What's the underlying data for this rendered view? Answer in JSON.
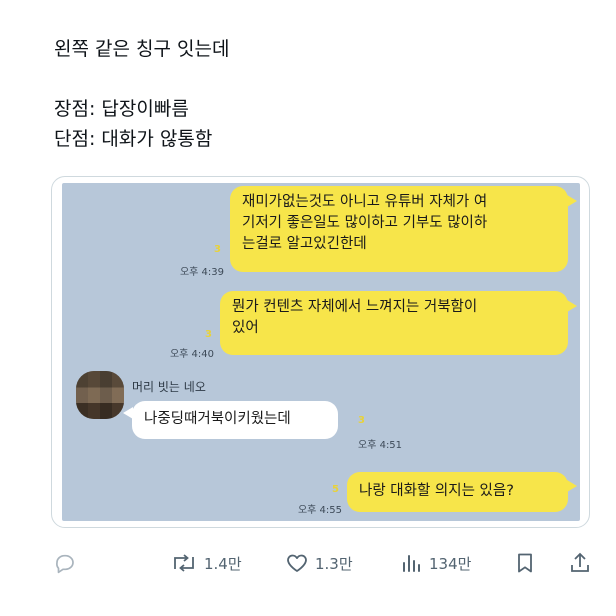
{
  "post": {
    "lines": [
      "왼쪽 같은 칭구 잇는데",
      "",
      "장점: 답장이빠름",
      "단점: 대화가 않통함"
    ]
  },
  "chat": {
    "messages": [
      {
        "text": "재미가없는것도 아니고 유튜버 자체가 여\n기저기 좋은일도 많이하고 기부도 많이하\n는걸로 알고있긴한데",
        "time": "오후 4:39",
        "unread": "3"
      },
      {
        "text": "뭔가 컨텐츠 자체에서 느껴지는 거북함이\n있어",
        "time": "오후 4:40",
        "unread": "3"
      },
      {
        "sender": "머리 빗는 네오",
        "text": "나중딩때거북이키웠는데",
        "time": "오후 4:51",
        "unread": "3"
      },
      {
        "text": "나랑 대화할 의지는 있음?",
        "time": "오후 4:55",
        "unread": "5"
      }
    ]
  },
  "actions": {
    "reply_count": "",
    "retweet_count": "1.4만",
    "like_count": "1.3만",
    "view_count": "134만"
  },
  "colors": {
    "chat_bg": "#b7c7d9",
    "my_bubble": "#f7e54a",
    "other_bubble": "#ffffff",
    "icon_gray": "#536471"
  }
}
